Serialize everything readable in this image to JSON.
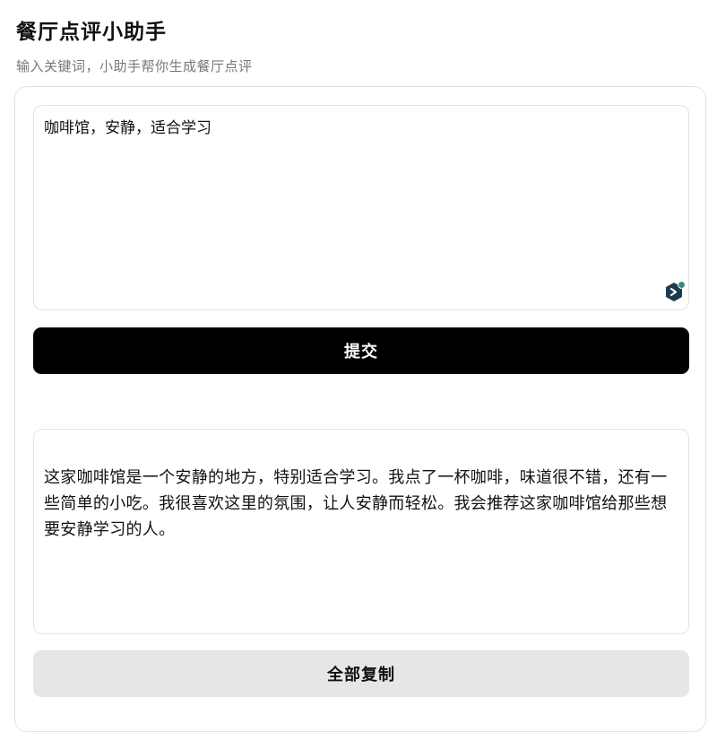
{
  "header": {
    "title": "餐厅点评小助手",
    "subtitle": "输入关键词，小助手帮你生成餐厅点评"
  },
  "input": {
    "value": "咖啡馆，安静，适合学习",
    "assist_icon": "ai-assistant-icon"
  },
  "actions": {
    "submit_label": "提交",
    "copy_label": "全部复制"
  },
  "output": {
    "text": "这家咖啡馆是一个安静的地方，特别适合学习。我点了一杯咖啡，味道很不错，还有一些简单的小吃。我很喜欢这里的氛围，让人安静而轻松。我会推荐这家咖啡馆给那些想要安静学习的人。"
  },
  "colors": {
    "primary_button": "#000000",
    "secondary_button": "#e6e6e8",
    "border": "#e3e3e3",
    "subtitle": "#777777",
    "assist_icon_body": "#1f3a4d",
    "assist_icon_dot": "#3d8a7c"
  }
}
